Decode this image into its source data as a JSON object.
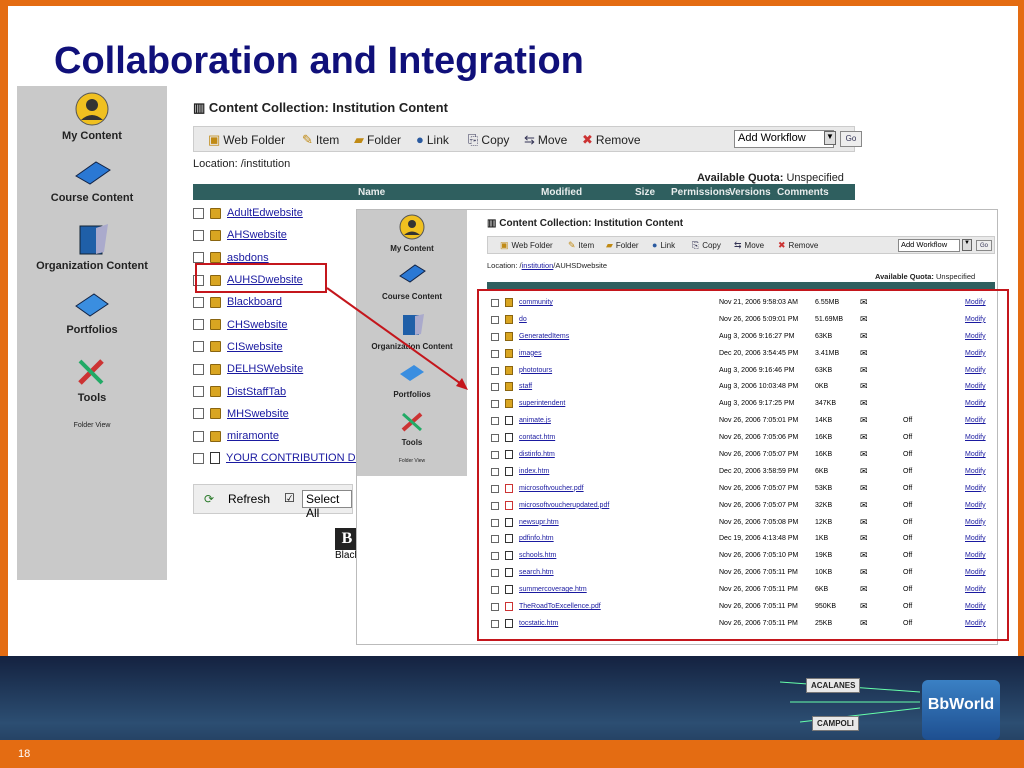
{
  "slide": {
    "title": "Collaboration and Integration",
    "page_number": "18"
  },
  "sidebar": {
    "items": [
      {
        "label": "My Content",
        "icon": "user-icon"
      },
      {
        "label": "Course Content",
        "icon": "book-icon"
      },
      {
        "label": "Organization Content",
        "icon": "organization-book-icon"
      },
      {
        "label": "Portfolios",
        "icon": "portfolio-icon"
      },
      {
        "label": "Tools",
        "icon": "tools-icon"
      }
    ],
    "folder_view": "Folder View"
  },
  "panel": {
    "title": "Content Collection: Institution Content",
    "toolbar": {
      "web_folder": "Web Folder",
      "item": "Item",
      "folder": "Folder",
      "link": "Link",
      "copy": "Copy",
      "move": "Move",
      "remove": "Remove",
      "workflow": "Add Workflow",
      "go": "Go"
    },
    "location": "Location: /institution",
    "quota_label": "Available Quota:",
    "quota_value": "Unspecified",
    "headers": {
      "name": "Name",
      "modified": "Modified",
      "size": "Size",
      "permissions": "Permissions",
      "versions": "Versions",
      "comments": "Comments"
    },
    "files": [
      "AdultEdwebsite",
      "AHSwebsite",
      "asbdons",
      "AUHSDwebsite",
      "Blackboard",
      "CHSwebsite",
      "CISwebsite",
      "DELHSWebsite",
      "DistStaffTab",
      "MHSwebsite",
      "miramonte",
      "YOUR CONTRIBUTION DC"
    ],
    "refresh": "Refresh",
    "select_all": "Select All",
    "logo_text": "Blackb"
  },
  "inner": {
    "title": "Content Collection: Institution Content",
    "location_prefix": "Location: /",
    "location_link": "institution",
    "location_suffix": "/AUHSDwebsite",
    "quota_label": "Available Quota:",
    "quota_value": "Unspecified",
    "modify": "Modify",
    "rows": [
      {
        "name": "community",
        "date": "Nov 21, 2006 9:58:03 AM",
        "size": "6.55MB",
        "versions": "",
        "type": "folder"
      },
      {
        "name": "do",
        "date": "Nov 26, 2006 5:09:01 PM",
        "size": "51.69MB",
        "versions": "",
        "type": "folder"
      },
      {
        "name": "GeneratedItems",
        "date": "Aug 3, 2006 9:16:27 PM",
        "size": "63KB",
        "versions": "",
        "type": "folder"
      },
      {
        "name": "images",
        "date": "Dec 20, 2006 3:54:45 PM",
        "size": "3.41MB",
        "versions": "",
        "type": "folder"
      },
      {
        "name": "phototours",
        "date": "Aug 3, 2006 9:16:46 PM",
        "size": "63KB",
        "versions": "",
        "type": "folder"
      },
      {
        "name": "staff",
        "date": "Aug 3, 2006 10:03:48 PM",
        "size": "0KB",
        "versions": "",
        "type": "folder"
      },
      {
        "name": "superintendent",
        "date": "Aug 3, 2006 9:17:25 PM",
        "size": "347KB",
        "versions": "",
        "type": "folder"
      },
      {
        "name": "animate.js",
        "date": "Nov 26, 2006 7:05:01 PM",
        "size": "14KB",
        "versions": "Off",
        "type": "file"
      },
      {
        "name": "contact.htm",
        "date": "Nov 26, 2006 7:05:06 PM",
        "size": "16KB",
        "versions": "Off",
        "type": "file"
      },
      {
        "name": "distinfo.htm",
        "date": "Nov 26, 2006 7:05:07 PM",
        "size": "16KB",
        "versions": "Off",
        "type": "file"
      },
      {
        "name": "index.htm",
        "date": "Dec 20, 2006 3:58:59 PM",
        "size": "6KB",
        "versions": "Off",
        "type": "file"
      },
      {
        "name": "microsoftvoucher.pdf",
        "date": "Nov 26, 2006 7:05:07 PM",
        "size": "53KB",
        "versions": "Off",
        "type": "pdf"
      },
      {
        "name": "microsoftvoucherupdated.pdf",
        "date": "Nov 26, 2006 7:05:07 PM",
        "size": "32KB",
        "versions": "Off",
        "type": "pdf"
      },
      {
        "name": "newsupr.htm",
        "date": "Nov 26, 2006 7:05:08 PM",
        "size": "12KB",
        "versions": "Off",
        "type": "file"
      },
      {
        "name": "pdfinfo.htm",
        "date": "Dec 19, 2006 4:13:48 PM",
        "size": "1KB",
        "versions": "Off",
        "type": "file"
      },
      {
        "name": "schools.htm",
        "date": "Nov 26, 2006 7:05:10 PM",
        "size": "19KB",
        "versions": "Off",
        "type": "file"
      },
      {
        "name": "search.htm",
        "date": "Nov 26, 2006 7:05:11 PM",
        "size": "10KB",
        "versions": "Off",
        "type": "file"
      },
      {
        "name": "summercoverage.htm",
        "date": "Nov 26, 2006 7:05:11 PM",
        "size": "6KB",
        "versions": "Off",
        "type": "file"
      },
      {
        "name": "TheRoadToExcellence.pdf",
        "date": "Nov 26, 2006 7:05:11 PM",
        "size": "950KB",
        "versions": "Off",
        "type": "pdf"
      },
      {
        "name": "tocstatic.htm",
        "date": "Nov 26, 2006 7:05:11 PM",
        "size": "25KB",
        "versions": "Off",
        "type": "file"
      }
    ]
  },
  "footer": {
    "badge1": "ACALANES",
    "badge2": "CAMPOLI",
    "bbworld": "BbWorld '07"
  },
  "colors": {
    "accent": "#e46c12",
    "title": "#10107a",
    "header": "#2f5f5f",
    "highlight": "#c4161c"
  }
}
